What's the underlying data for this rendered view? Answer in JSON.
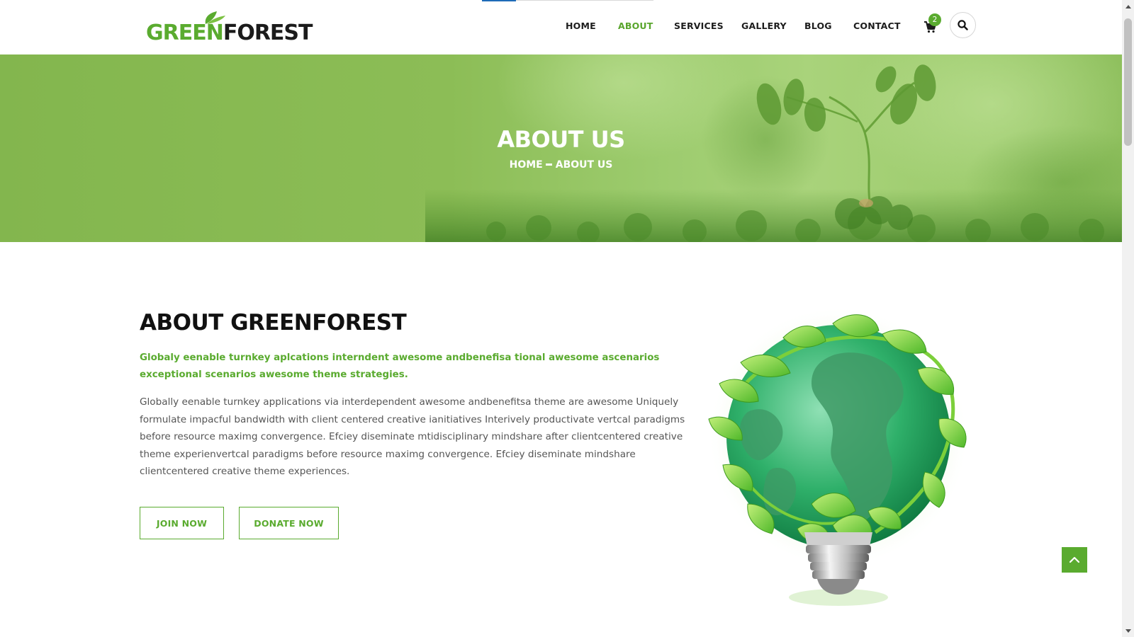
{
  "logo": {
    "part1": "GREEN",
    "part2": "FOREST"
  },
  "nav": {
    "items": [
      {
        "label": "HOME",
        "active": false
      },
      {
        "label": "ABOUT",
        "active": true
      },
      {
        "label": "SERVICES",
        "active": false
      },
      {
        "label": "GALLERY",
        "active": false
      },
      {
        "label": "BLOG",
        "active": false
      },
      {
        "label": "CONTACT",
        "active": false
      }
    ],
    "cart_count": "2",
    "cart_icon": "shopping-cart-icon",
    "search_icon": "search-icon"
  },
  "hero": {
    "title": "ABOUT US",
    "breadcrumb": {
      "home": "HOME",
      "current": "ABOUT US"
    }
  },
  "about": {
    "title": "ABOUT GREENFOREST",
    "lead": "Globaly eenable turnkey aplcations interndent awesome andbenefisa tional awesome ascenarios exceptional scenarios awesome theme strategies.",
    "body": "Globally eenable turnkey applications via interdependent awesome andbenefitsa theme are awesome Uniquely formulate impacful bandwidth with client centered creative ianitiatives Interively productivate vertcal paradigms before resource maximg convergence. Efciey diseminate mtidisciplinary mindshare after clientcentered creative theme experienvertcal paradigms before resource maximg convergence. Efciey diseminate mindshare clientcentered creative theme experiences.",
    "join_label": "JOIN NOW",
    "donate_label": "DONATE NOW"
  },
  "colors": {
    "brand_green": "#5aab2f",
    "hero_green": "#8cbd56",
    "text_dark": "#111111",
    "text_body": "#555555"
  }
}
